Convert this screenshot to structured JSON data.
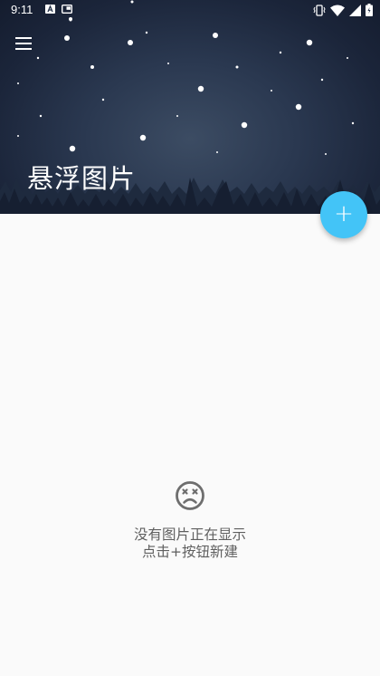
{
  "status_bar": {
    "time": "9:11",
    "left_icons": [
      "font-a-icon",
      "picture-in-picture-icon",
      "notification-dot-icon"
    ],
    "right_icons": [
      "vibrate-icon",
      "wifi-icon",
      "signal-icon",
      "battery-icon"
    ]
  },
  "header": {
    "title": "悬浮图片",
    "menu_icon": "hamburger-menu-icon",
    "background": "night-sky-with-stars-and-pine-trees"
  },
  "fab": {
    "label": "+",
    "icon": "plus-icon",
    "color": "#43c4f7"
  },
  "empty_state": {
    "icon": "dizzy-face-icon",
    "line1": "没有图片正在显示",
    "line2": "点击+按钮新建"
  },
  "colors": {
    "background": "#fafafa",
    "accent": "#43c4f7",
    "empty_text": "#5f5f5f"
  }
}
